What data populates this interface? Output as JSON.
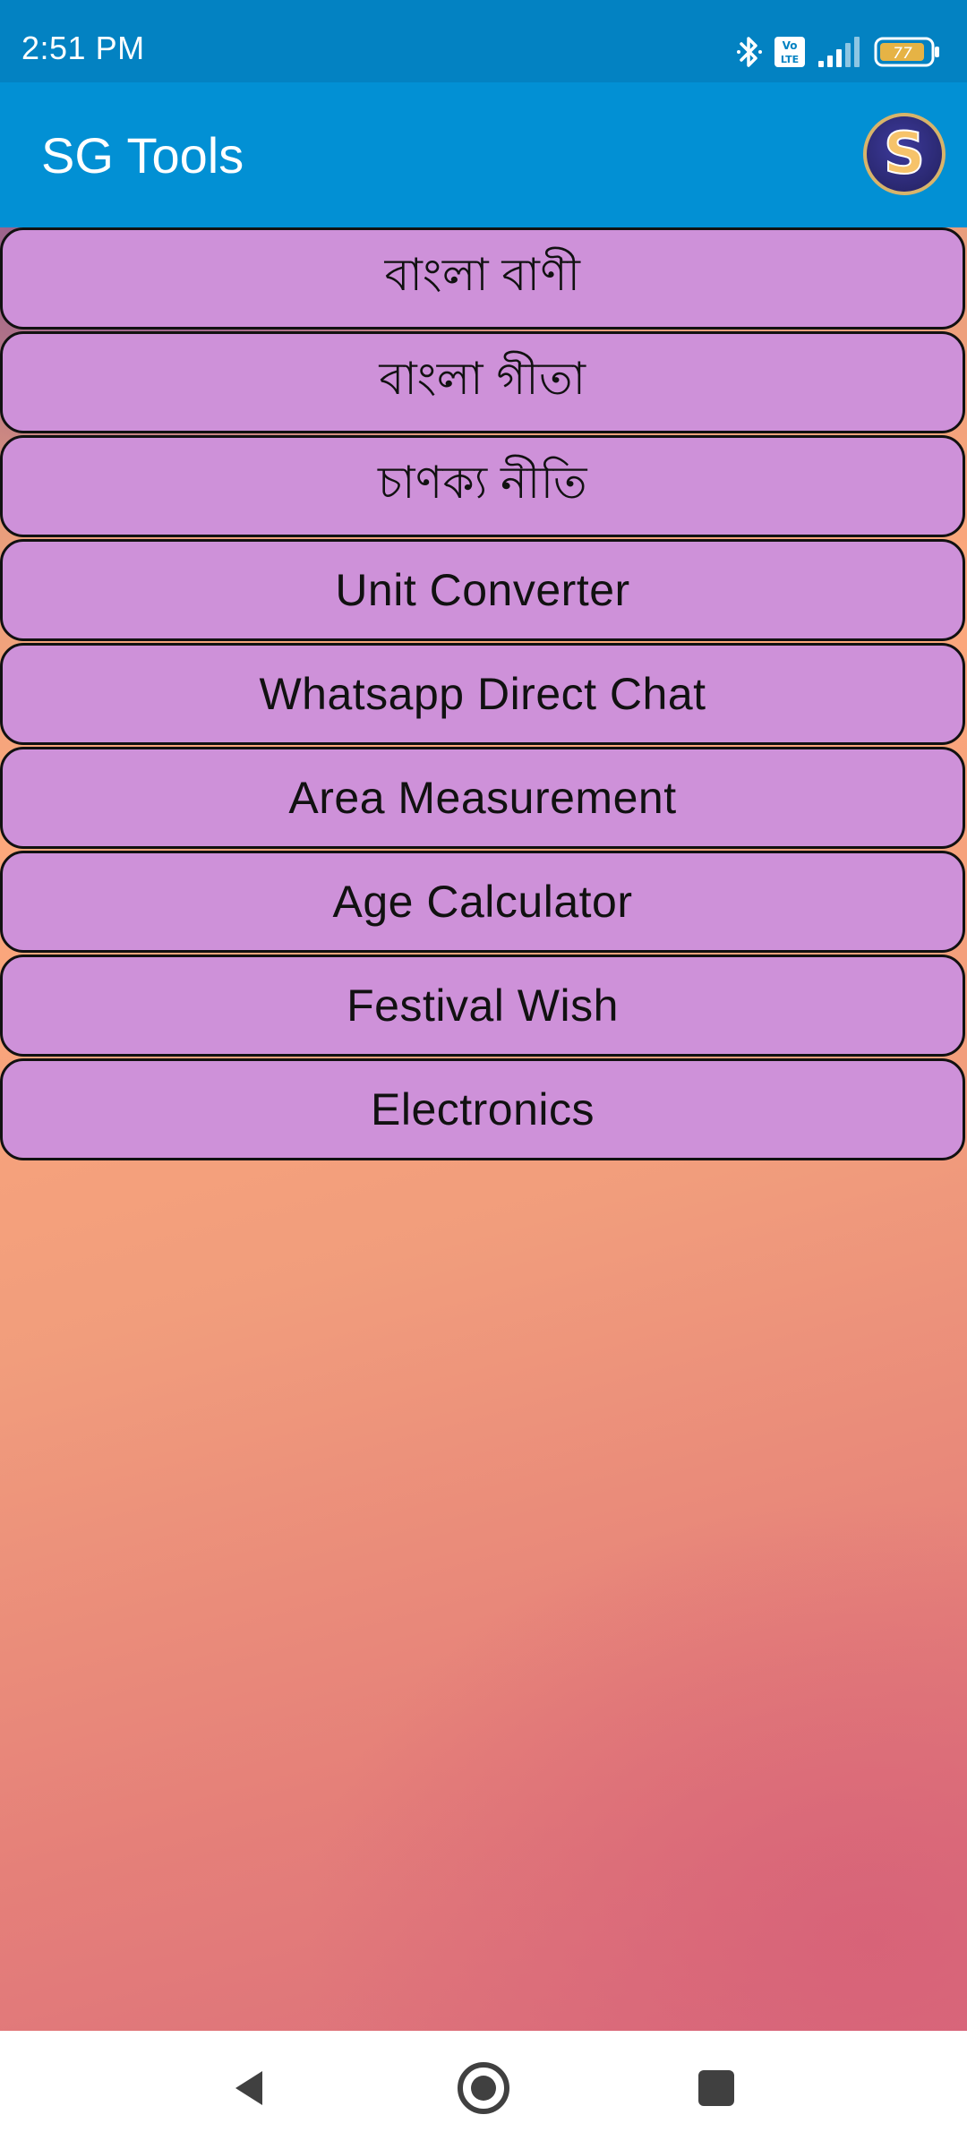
{
  "status_bar": {
    "time": "2:51 PM",
    "network_badge": "Vo LTE",
    "battery": "77",
    "icons": [
      "bluetooth-icon",
      "volte-icon",
      "signal-icon",
      "battery-icon"
    ]
  },
  "app_bar": {
    "title": "SG Tools",
    "avatar_letter": "S"
  },
  "menu": {
    "items": [
      {
        "label": "বাংলা বাণী"
      },
      {
        "label": "বাংলা গীতা"
      },
      {
        "label": "চাণক্য নীতি"
      },
      {
        "label": "Unit Converter"
      },
      {
        "label": "Whatsapp Direct Chat"
      },
      {
        "label": "Area Measurement"
      },
      {
        "label": "Age Calculator"
      },
      {
        "label": "Festival Wish"
      },
      {
        "label": "Electronics"
      }
    ]
  },
  "nav": {
    "icons": [
      "back-icon",
      "home-icon",
      "recents-icon"
    ]
  },
  "colors": {
    "status_bar": "#0382c2",
    "app_bar": "#0290d4",
    "button_fill": "#ce91d9",
    "button_border": "#111111",
    "accent_gold": "#d8b46a"
  }
}
